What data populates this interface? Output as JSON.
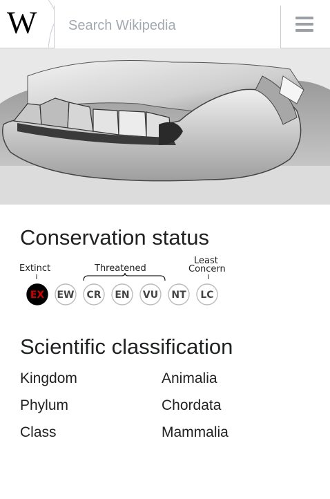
{
  "header": {
    "logo": "W",
    "search_placeholder": "Search Wikipedia"
  },
  "conservation": {
    "title": "Conservation status",
    "labels": {
      "extinct": "Extinct",
      "threatened": "Threatened",
      "least_concern_1": "Least",
      "least_concern_2": "Concern"
    },
    "statuses": [
      "EX",
      "EW",
      "CR",
      "EN",
      "VU",
      "NT",
      "LC"
    ],
    "selected": "EX",
    "selected_color": "#d10000"
  },
  "classification": {
    "title": "Scientific classification",
    "rows": [
      {
        "rank": "Kingdom",
        "value": "Animalia"
      },
      {
        "rank": "Phylum",
        "value": "Chordata"
      },
      {
        "rank": "Class",
        "value": "Mammalia"
      }
    ]
  }
}
